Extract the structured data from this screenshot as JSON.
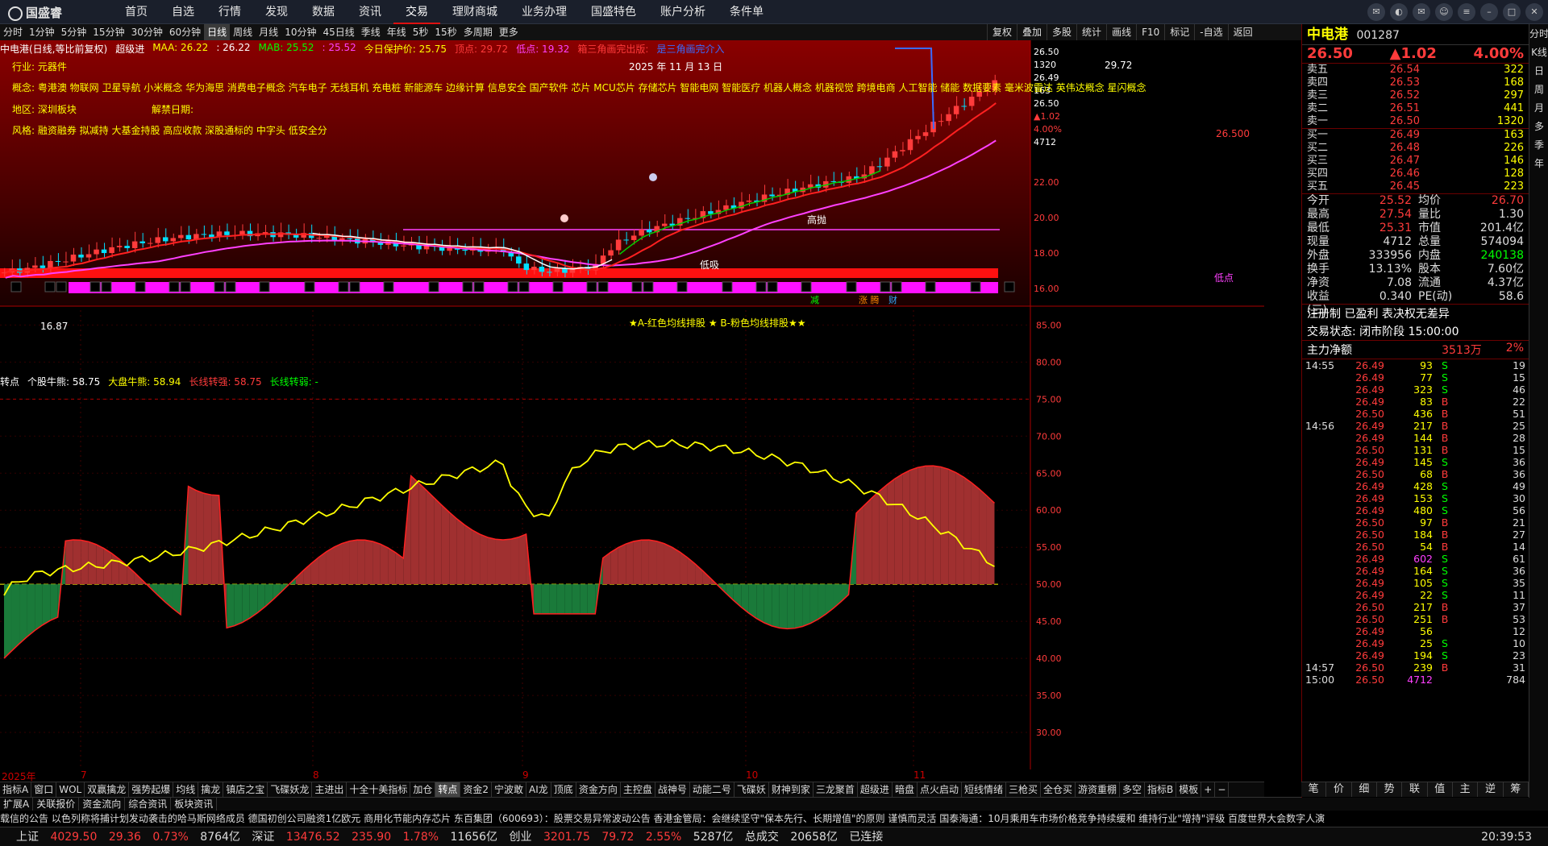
{
  "app": {
    "logo": "国盛睿"
  },
  "nav": [
    "首页",
    "自选",
    "行情",
    "发现",
    "数据",
    "资讯",
    "交易",
    "理财商城",
    "业务办理",
    "国盛特色",
    "账户分析",
    "条件单"
  ],
  "periods": [
    "分时",
    "1分钟",
    "5分钟",
    "15分钟",
    "30分钟",
    "60分钟",
    "日线",
    "周线",
    "月线",
    "10分钟",
    "45日线",
    "季线",
    "年线",
    "5秒",
    "15秒",
    "多周期",
    "更多"
  ],
  "toolbar": [
    "复权",
    "叠加",
    "多股",
    "统计",
    "画线",
    "F10",
    "标记",
    "-自选",
    "返回"
  ],
  "legend": {
    "title": "中电港(日线,等比前复权)",
    "ind": "超级进",
    "maa": "MAA: 26.22",
    "v1": ": 26.22",
    "mab": "MAB: 25.52",
    "v2": ": 25.52",
    "protect": "今日保护价: 25.75",
    "top": "顶点: 29.72",
    "bottom": "低点: 19.32",
    "tri1": "箱三角画完出版:",
    "tri2": "是三角画完介入"
  },
  "info": {
    "industry": "行业: 元器件",
    "concepts": "概念: 粤港澳 物联网 卫星导航 小米概念 华为海思 消费电子概念 汽车电子 无线耳机 充电桩 新能源车 边缘计算 信息安全 国产软件 芯片 MCU芯片 存储芯片 智能电网 智能医疗 机器人概念 机器视觉 跨境电商 人工智能 储能 数据要素 毫米波雷达 英伟达概念 星闪概念",
    "region": "地区: 深圳板块",
    "ban": "解禁日期:",
    "style": "风格: 融资融券 拟减持 大基金持股 高应收款 深股通标的 中字头 低安全分",
    "date": "2025 年 11 月 13 日",
    "banner": "★A-红色均线排股 ★ B-粉色均线排股★★",
    "peak": "29.72",
    "low_tag": "低点",
    "marker_high": "高抛",
    "marker_low": "低吸",
    "start": "16.87",
    "last": "26.500"
  },
  "legend2": {
    "a": "转点",
    "b": "个股牛熊: 58.75",
    "c": "大盘牛熊: 58.94",
    "d": "长线转强: 58.75",
    "e": "长线转弱: -"
  },
  "xaxis": [
    "2025年",
    "7",
    "8",
    "9",
    "10",
    "11"
  ],
  "yaxis_top": [
    "22.00",
    "20.00",
    "18.00",
    "16.00"
  ],
  "yaxis_bot": [
    "85.00",
    "80.00",
    "75.00",
    "70.00",
    "65.00",
    "60.00",
    "55.00",
    "50.00",
    "45.00",
    "40.00",
    "35.00",
    "30.00"
  ],
  "right_top_axis": [
    "26.50",
    "1320",
    "26.49",
    "163",
    "26.50",
    "▲1.02",
    "4.00%",
    "4712"
  ],
  "bottabs": [
    "指标A",
    "窗口",
    "WOL",
    "双赢擒龙",
    "强势起爆",
    "均线",
    "擒龙",
    "镇店之宝",
    "飞碟妖龙",
    "主进出",
    "十全十美指标",
    "加仓",
    "转点",
    "资金2",
    "宁波敢",
    "AI龙",
    "顶底",
    "资金方向",
    "主控盘",
    "战神号",
    "动能二号",
    "飞碟妖",
    "财神到家",
    "三龙聚首",
    "超级进",
    "暗盘",
    "点火启动",
    "短线情绪",
    "三枪买",
    "全仓买",
    "游资重棚",
    "多空",
    "指标B",
    "模板",
    "+",
    "−"
  ],
  "bottabs2": [
    "扩展A",
    "关联报价",
    "资金流向",
    "综合资讯",
    "板块资讯"
  ],
  "ticker": "载信的公告     以色列称将捕计划发动袭击的哈马斯网络成员     德国初创公司融资1亿欧元 商用化节能内存芯片     东百集团（600693）：股票交易异常波动公告     香港金管局：会继续坚守\"保本先行、长期增值\"的原则 谨慎而灵活     国泰海通：10月乘用车市场价格竞争持续缓和 维持行业\"增持\"评级     百度世界大会数字人演",
  "status": {
    "sh": "上证",
    "sh_v": "4029.50",
    "sh_c": "29.36",
    "sh_p": "0.73%",
    "sh_a": "8764亿",
    "sz": "深证",
    "sz_v": "13476.52",
    "sz_c": "235.90",
    "sz_p": "1.78%",
    "sz_a": "11656亿",
    "cy": "创业",
    "cy_v": "3201.75",
    "cy_c": "79.72",
    "cy_p": "2.55%",
    "cy_a": "5287亿",
    "tot": "总成交",
    "tot_v": "20658亿",
    "conn": "已连接",
    "time": "20:39:53"
  },
  "rp": {
    "name": "中电港",
    "code": "001287",
    "price": "26.50",
    "chg": "▲1.02",
    "pct": "4.00%",
    "asks": [
      [
        "卖五",
        "26.54",
        "322"
      ],
      [
        "卖四",
        "26.53",
        "168"
      ],
      [
        "卖三",
        "26.52",
        "297"
      ],
      [
        "卖二",
        "26.51",
        "441"
      ],
      [
        "卖一",
        "26.50",
        "1320"
      ]
    ],
    "bids": [
      [
        "买一",
        "26.49",
        "163"
      ],
      [
        "买二",
        "26.48",
        "226"
      ],
      [
        "买三",
        "26.47",
        "146"
      ],
      [
        "买四",
        "26.46",
        "128"
      ],
      [
        "买五",
        "26.45",
        "223"
      ]
    ],
    "stats": [
      [
        "今开",
        "25.52",
        "均价",
        "26.70"
      ],
      [
        "最高",
        "27.54",
        "量比",
        "1.30"
      ],
      [
        "最低",
        "25.31",
        "市值",
        "201.4亿"
      ],
      [
        "现量",
        "4712",
        "总量",
        "574094"
      ],
      [
        "外盘",
        "333956",
        "内盘",
        "240138"
      ],
      [
        "换手",
        "13.13%",
        "股本",
        "7.60亿"
      ],
      [
        "净资",
        "7.08",
        "流通",
        "4.37亿"
      ],
      [
        "收益(三)",
        "0.340",
        "PE(动)",
        "58.6"
      ]
    ],
    "reg": "注册制 已盈利 表决权无差异",
    "trade": "交易状态: 闭市阶段 15:00:00",
    "flow": "主力净额",
    "flow_v": "3513万",
    "flow_p": "2%",
    "ticks": [
      [
        "14:55",
        "26.49",
        "93",
        "S",
        "19"
      ],
      [
        "",
        "26.49",
        "77",
        "S",
        "15"
      ],
      [
        "",
        "26.49",
        "323",
        "S",
        "46"
      ],
      [
        "",
        "26.49",
        "83",
        "B",
        "22"
      ],
      [
        "",
        "26.50",
        "436",
        "B",
        "51"
      ],
      [
        "14:56",
        "26.49",
        "217",
        "B",
        "25"
      ],
      [
        "",
        "26.49",
        "144",
        "B",
        "28"
      ],
      [
        "",
        "26.50",
        "131",
        "B",
        "15"
      ],
      [
        "",
        "26.49",
        "145",
        "S",
        "36"
      ],
      [
        "",
        "26.50",
        "68",
        "B",
        "36"
      ],
      [
        "",
        "26.49",
        "428",
        "S",
        "49"
      ],
      [
        "",
        "26.49",
        "153",
        "S",
        "30"
      ],
      [
        "",
        "26.49",
        "480",
        "S",
        "56"
      ],
      [
        "",
        "26.50",
        "97",
        "B",
        "21"
      ],
      [
        "",
        "26.50",
        "184",
        "B",
        "27"
      ],
      [
        "",
        "26.50",
        "54",
        "B",
        "14"
      ],
      [
        "",
        "26.49",
        "602",
        "S",
        "61"
      ],
      [
        "",
        "26.49",
        "164",
        "S",
        "36"
      ],
      [
        "",
        "26.49",
        "105",
        "S",
        "35"
      ],
      [
        "",
        "26.49",
        "22",
        "S",
        "11"
      ],
      [
        "",
        "26.50",
        "217",
        "B",
        "37"
      ],
      [
        "",
        "26.50",
        "251",
        "B",
        "53"
      ],
      [
        "",
        "26.49",
        "56",
        "",
        "12"
      ],
      [
        "",
        "26.49",
        "25",
        "S",
        "10"
      ],
      [
        "",
        "26.49",
        "194",
        "S",
        "23"
      ],
      [
        "14:57",
        "26.50",
        "239",
        "B",
        "31"
      ],
      [
        "15:00",
        "26.50",
        "4712",
        "",
        "784"
      ]
    ],
    "vtabs": [
      "分时",
      "K线",
      "日",
      "周",
      "月",
      "多",
      "季",
      "年"
    ],
    "btabs": [
      "笔",
      "价",
      "细",
      "势",
      "联",
      "值",
      "主",
      "逆",
      "筹"
    ]
  },
  "colors": {
    "up": "#ff3b3b",
    "down": "#00e0ff",
    "ma_red": "#ff2020",
    "ma_mag": "#ff40ff",
    "ma_white": "#ffffff",
    "ma_green": "#00cc00",
    "yellow": "#ffff00"
  },
  "chart_data": [
    {
      "type": "candlestick",
      "title": "中电港(日线,等比前复权)",
      "ylim": [
        15,
        30
      ],
      "x": [
        "2025年",
        "7",
        "8",
        "9",
        "10",
        "11"
      ],
      "annotations": [
        "顶点: 29.72",
        "低点: 19.32",
        "高抛",
        "低吸",
        "16.87"
      ]
    },
    {
      "type": "area",
      "title": "转点",
      "ylim": [
        25,
        87
      ],
      "series": [
        {
          "name": "个股牛熊",
          "last": 58.75
        },
        {
          "name": "大盘牛熊",
          "last": 58.94
        }
      ],
      "baseline": 50
    }
  ]
}
